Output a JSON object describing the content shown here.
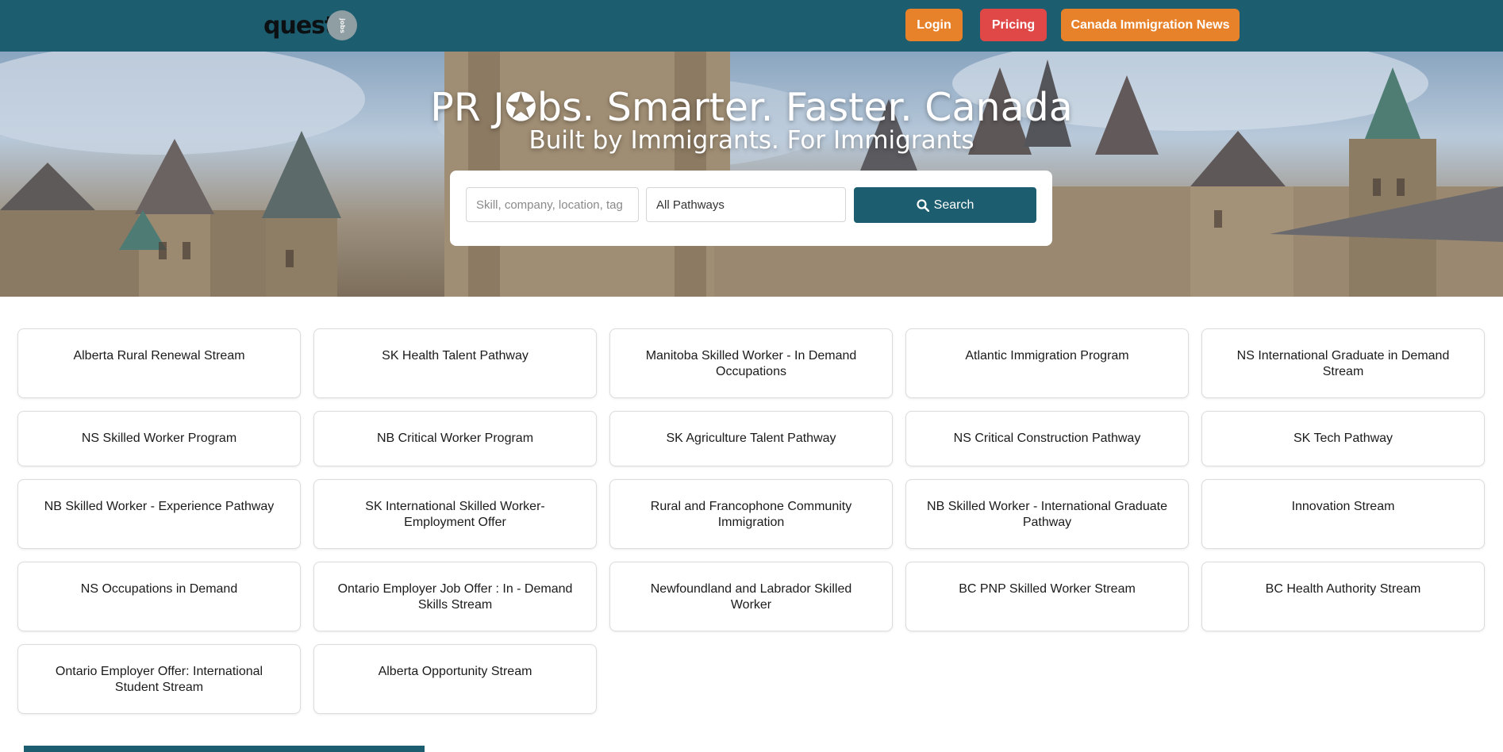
{
  "brand": {
    "logo_text": "quest",
    "logo_badge": "jobs"
  },
  "nav": {
    "login": "Login",
    "pricing": "Pricing",
    "news": "Canada Immigration News"
  },
  "hero": {
    "title": "PR J✪bs. Smarter. Faster. Canada",
    "subtitle": "Built by Immigrants. For Immigrants"
  },
  "search": {
    "placeholder": "Skill, company, location, tag",
    "pathway_selected": "All Pathways",
    "button_label": "Search"
  },
  "pathways": [
    "Alberta Rural Renewal Stream",
    "SK Health Talent Pathway",
    "Manitoba Skilled Worker - In Demand Occupations",
    "Atlantic Immigration Program",
    "NS International Graduate in Demand Stream",
    "NS Skilled Worker Program",
    "NB Critical Worker Program",
    "SK Agriculture Talent Pathway",
    "NS Critical Construction Pathway",
    "SK Tech Pathway",
    "NB Skilled Worker - Experience Pathway",
    "SK International Skilled Worker- Employment Offer",
    "Rural and Francophone Community Immigration",
    "NB Skilled Worker - International Graduate Pathway",
    "Innovation Stream",
    "NS Occupations in Demand",
    "Ontario Employer Job Offer : In - Demand Skills Stream",
    "Newfoundland and Labrador Skilled Worker",
    "BC PNP Skilled Worker Stream",
    "BC Health Authority Stream",
    "Ontario Employer Offer: International Student Stream",
    "Alberta Opportunity Stream"
  ],
  "colors": {
    "header": "#1c5e6f",
    "orange": "#e8822a",
    "red": "#e04848"
  }
}
